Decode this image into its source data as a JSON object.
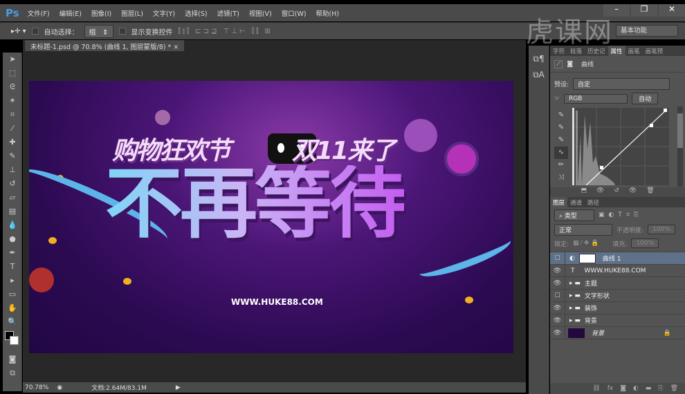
{
  "app": {
    "logo": "Ps",
    "minimize": "–",
    "close": "✕",
    "restore": "❐"
  },
  "menu": [
    "文件(F)",
    "编辑(E)",
    "图像(I)",
    "图层(L)",
    "文字(Y)",
    "选择(S)",
    "滤镜(T)",
    "视图(V)",
    "窗口(W)",
    "帮助(H)"
  ],
  "options": {
    "auto_select_label": "自动选择：",
    "auto_select_value": "组",
    "show_transform_label": "显示变换控件",
    "workspace": "基本功能"
  },
  "document": {
    "tab_title": "未标题-1.psd @ 70.8% (曲线 1, 图层蒙版/8) *",
    "tab_close": "×",
    "zoom": "70.78%",
    "doc_size": "文档:2.64M/83.1M"
  },
  "artwork": {
    "headline_left": "购物狂欢节",
    "headline_right": "双11来了",
    "main_title": "不再等待",
    "url": "WWW.HUKE88.COM"
  },
  "properties": {
    "tabs": [
      "字符",
      "段落",
      "历史记",
      "属性",
      "画笔",
      "画笔预"
    ],
    "active_tab": "属性",
    "title": "曲线",
    "preset_label": "预设:",
    "preset_value": "自定",
    "channel": "RGB",
    "auto_button": "自动"
  },
  "layers": {
    "tabs": [
      "图层",
      "通道",
      "路径"
    ],
    "filter": "类型",
    "blend_mode": "正常",
    "opacity_label": "不透明度:",
    "opacity": "100%",
    "lock_label": "锁定:",
    "fill_label": "填充:",
    "fill": "100%",
    "items": [
      {
        "name": "曲线 1",
        "visible": false,
        "type": "adjustment",
        "selected": true
      },
      {
        "name": "WWW.HUKE88.COM",
        "visible": true,
        "type": "text"
      },
      {
        "name": "主题",
        "visible": true,
        "type": "group"
      },
      {
        "name": "文字形状",
        "visible": false,
        "type": "group"
      },
      {
        "name": "装饰",
        "visible": true,
        "type": "group"
      },
      {
        "name": "背景",
        "visible": true,
        "type": "group"
      },
      {
        "name": "背景",
        "visible": true,
        "type": "background",
        "locked": true
      }
    ]
  },
  "watermark": "虎课网"
}
